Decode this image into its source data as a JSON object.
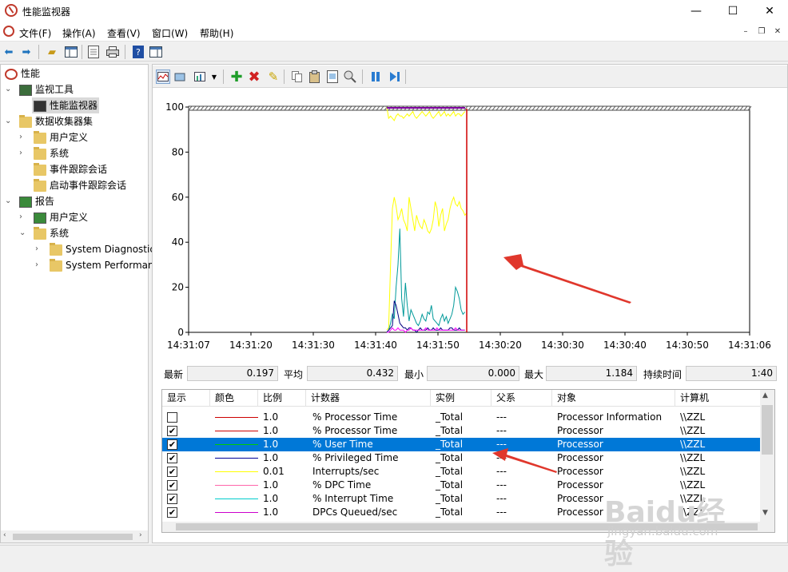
{
  "window": {
    "title": "性能监视器",
    "minimize": "—",
    "maximize": "☐",
    "close": "✕"
  },
  "menu": {
    "items": [
      "文件(F)",
      "操作(A)",
      "查看(V)",
      "窗口(W)",
      "帮助(H)"
    ],
    "mdi_min": "–",
    "mdi_restore": "❐",
    "mdi_close": "✕"
  },
  "toolbar": {
    "icons": [
      "back-icon",
      "forward-icon",
      "up-folder-icon",
      "show-hide-tree-icon",
      "properties-icon",
      "print-icon",
      "help-icon",
      "show-hide-action-icon"
    ]
  },
  "tree": {
    "root": "性能",
    "items": [
      {
        "label": "监视工具",
        "level": 1,
        "expanded": true
      },
      {
        "label": "性能监视器",
        "level": 2,
        "selected": true
      },
      {
        "label": "数据收集器集",
        "level": 1,
        "expanded": true
      },
      {
        "label": "用户定义",
        "level": 2
      },
      {
        "label": "系统",
        "level": 2
      },
      {
        "label": "事件跟踪会话",
        "level": 2
      },
      {
        "label": "启动事件跟踪会话",
        "level": 2
      },
      {
        "label": "报告",
        "level": 1,
        "expanded": true
      },
      {
        "label": "用户定义",
        "level": 2
      },
      {
        "label": "系统",
        "level": 2,
        "expanded": true
      },
      {
        "label": "System Diagnostics",
        "level": 3
      },
      {
        "label": "System Performance",
        "level": 3
      }
    ]
  },
  "graph_toolbar": {
    "icons": [
      "view-current-activity-icon",
      "change-graph-type-icon",
      "graph-type-dropdown-icon",
      "add-counter-icon",
      "delete-counter-icon",
      "highlight-icon",
      "copy-properties-icon",
      "paste-counter-list-icon",
      "properties-icon",
      "zoom-icon",
      "freeze-display-icon",
      "update-data-icon"
    ]
  },
  "chart_data": {
    "type": "line",
    "title": "",
    "xlabel": "",
    "ylabel": "",
    "ylim": [
      0,
      100
    ],
    "y_ticks": [
      "100",
      "80",
      "60",
      "40",
      "20",
      "0"
    ],
    "x_ticks": [
      "14:31:07",
      "14:31:20",
      "14:31:30",
      "14:31:40",
      "14:31:50",
      "14:30:20",
      "14:30:30",
      "14:30:40",
      "14:30:50",
      "14:31:06"
    ],
    "grid": false,
    "series": [
      {
        "color": "#ffff00",
        "values": [
          null,
          null,
          null,
          null,
          null,
          null,
          null,
          null,
          null,
          null,
          null,
          null,
          null,
          null,
          null,
          null,
          null,
          null,
          null,
          null,
          null,
          null,
          null,
          null,
          null,
          null,
          null,
          null,
          null,
          null,
          null,
          null,
          null,
          null,
          null,
          null,
          null,
          null,
          null,
          null,
          null,
          null,
          null,
          null,
          null,
          null,
          null,
          null,
          1,
          2,
          30,
          55,
          60,
          56,
          50,
          52,
          55,
          50,
          48,
          45,
          60,
          55,
          50,
          45,
          52,
          49,
          47,
          46,
          50,
          48,
          45,
          44,
          46,
          50,
          58,
          55,
          47,
          52,
          55,
          45,
          48,
          50,
          55,
          58,
          60,
          57,
          56,
          58,
          55,
          54,
          52,
          53,
          null
        ]
      },
      {
        "color": "#009999",
        "values": [
          null,
          null,
          null,
          null,
          null,
          null,
          null,
          null,
          null,
          null,
          null,
          null,
          null,
          null,
          null,
          null,
          null,
          null,
          null,
          null,
          null,
          null,
          null,
          null,
          null,
          null,
          null,
          null,
          null,
          null,
          null,
          null,
          null,
          null,
          null,
          null,
          null,
          null,
          null,
          null,
          null,
          null,
          null,
          null,
          null,
          null,
          null,
          null,
          0,
          1,
          4,
          8,
          6,
          20,
          30,
          46,
          15,
          7,
          22,
          12,
          5,
          10,
          8,
          6,
          4,
          3,
          5,
          8,
          6,
          5,
          9,
          8,
          12,
          6,
          5,
          4,
          3,
          6,
          8,
          5,
          7,
          4,
          6,
          8,
          12,
          20,
          18,
          15,
          10,
          8,
          9,
          null
        ]
      },
      {
        "color": "#000080",
        "values": [
          null,
          null,
          null,
          null,
          null,
          null,
          null,
          null,
          null,
          null,
          null,
          null,
          null,
          null,
          null,
          null,
          null,
          null,
          null,
          null,
          null,
          null,
          null,
          null,
          null,
          null,
          null,
          null,
          null,
          null,
          null,
          null,
          null,
          null,
          null,
          null,
          null,
          null,
          null,
          null,
          null,
          null,
          null,
          null,
          null,
          null,
          null,
          null,
          0,
          1,
          2,
          3,
          14,
          12,
          8,
          4,
          3,
          2,
          2,
          1,
          2,
          2,
          1,
          1,
          0,
          1,
          2,
          1,
          1,
          1,
          2,
          1,
          1,
          2,
          1,
          1,
          1,
          2,
          1,
          1,
          1,
          1,
          2,
          2,
          1,
          1,
          1,
          2,
          1,
          1,
          1,
          null
        ]
      },
      {
        "color": "#ff00ff",
        "values": [
          null,
          null,
          null,
          null,
          null,
          null,
          null,
          null,
          null,
          null,
          null,
          null,
          null,
          null,
          null,
          null,
          null,
          null,
          null,
          null,
          null,
          null,
          null,
          null,
          null,
          null,
          null,
          null,
          null,
          null,
          null,
          null,
          null,
          null,
          null,
          null,
          null,
          null,
          null,
          null,
          null,
          null,
          null,
          null,
          null,
          null,
          null,
          null,
          0,
          0,
          1,
          2,
          1,
          1,
          2,
          1,
          1,
          1,
          0,
          1,
          1,
          2,
          1,
          1,
          1,
          1,
          1,
          1,
          1,
          2,
          1,
          1,
          1,
          1,
          1,
          2,
          1,
          1,
          1,
          1,
          1,
          1,
          1,
          1,
          1,
          2,
          1,
          1,
          1,
          1,
          1,
          null
        ]
      },
      {
        "color": "#ffff00",
        "name_hint": "upper",
        "values": [
          null,
          null,
          null,
          null,
          null,
          null,
          null,
          null,
          null,
          null,
          null,
          null,
          null,
          null,
          null,
          null,
          null,
          null,
          null,
          null,
          null,
          null,
          null,
          null,
          null,
          null,
          null,
          null,
          null,
          null,
          null,
          null,
          null,
          null,
          null,
          null,
          null,
          null,
          null,
          null,
          null,
          null,
          null,
          null,
          null,
          null,
          null,
          null,
          100,
          95,
          96,
          95,
          94,
          96,
          97,
          96,
          96,
          95,
          96,
          97,
          96,
          97,
          98,
          96,
          95,
          96,
          97,
          98,
          97,
          96,
          97,
          98,
          96,
          95,
          96,
          97,
          98,
          96,
          97,
          98,
          96,
          97,
          96,
          97,
          98,
          96,
          97,
          97,
          96,
          97,
          98,
          null
        ]
      }
    ]
  },
  "stats": {
    "last_label": "最新",
    "last_value": "0.197",
    "avg_label": "平均",
    "avg_value": "0.432",
    "min_label": "最小",
    "min_value": "0.000",
    "max_label": "最大",
    "max_value": "1.184",
    "duration_label": "持续时间",
    "duration_value": "1:40"
  },
  "table": {
    "headers": [
      "显示",
      "颜色",
      "比例",
      "计数器",
      "实例",
      "父系",
      "对象",
      "计算机"
    ],
    "rows": [
      {
        "checked": false,
        "color": "#cc0000",
        "scale": "1.0",
        "counter": "% Processor Time",
        "instance": "_Total",
        "parent": "---",
        "object": "Processor Information",
        "computer": "\\\\ZZL"
      },
      {
        "checked": true,
        "color": "#cc0000",
        "scale": "1.0",
        "counter": "% Processor Time",
        "instance": "_Total",
        "parent": "---",
        "object": "Processor",
        "computer": "\\\\ZZL"
      },
      {
        "checked": true,
        "color": "#00cc00",
        "scale": "1.0",
        "counter": "% User Time",
        "instance": "_Total",
        "parent": "---",
        "object": "Processor",
        "computer": "\\\\ZZL",
        "selected": true
      },
      {
        "checked": true,
        "color": "#000099",
        "scale": "1.0",
        "counter": "% Privileged Time",
        "instance": "_Total",
        "parent": "---",
        "object": "Processor",
        "computer": "\\\\ZZL"
      },
      {
        "checked": true,
        "color": "#ffff00",
        "scale": "0.01",
        "counter": "Interrupts/sec",
        "instance": "_Total",
        "parent": "---",
        "object": "Processor",
        "computer": "\\\\ZZL"
      },
      {
        "checked": true,
        "color": "#ff66aa",
        "scale": "1.0",
        "counter": "% DPC Time",
        "instance": "_Total",
        "parent": "---",
        "object": "Processor",
        "computer": "\\\\ZZL"
      },
      {
        "checked": true,
        "color": "#00cccc",
        "scale": "1.0",
        "counter": "% Interrupt Time",
        "instance": "_Total",
        "parent": "---",
        "object": "Processor",
        "computer": "\\\\ZZL"
      },
      {
        "checked": true,
        "color": "#cc00cc",
        "scale": "1.0",
        "counter": "DPCs Queued/sec",
        "instance": "_Total",
        "parent": "---",
        "object": "Processor",
        "computer": "\\\\ZZL"
      }
    ]
  },
  "watermark": {
    "text": "Baidu经验",
    "sub": "jingyan.baidu.com"
  }
}
